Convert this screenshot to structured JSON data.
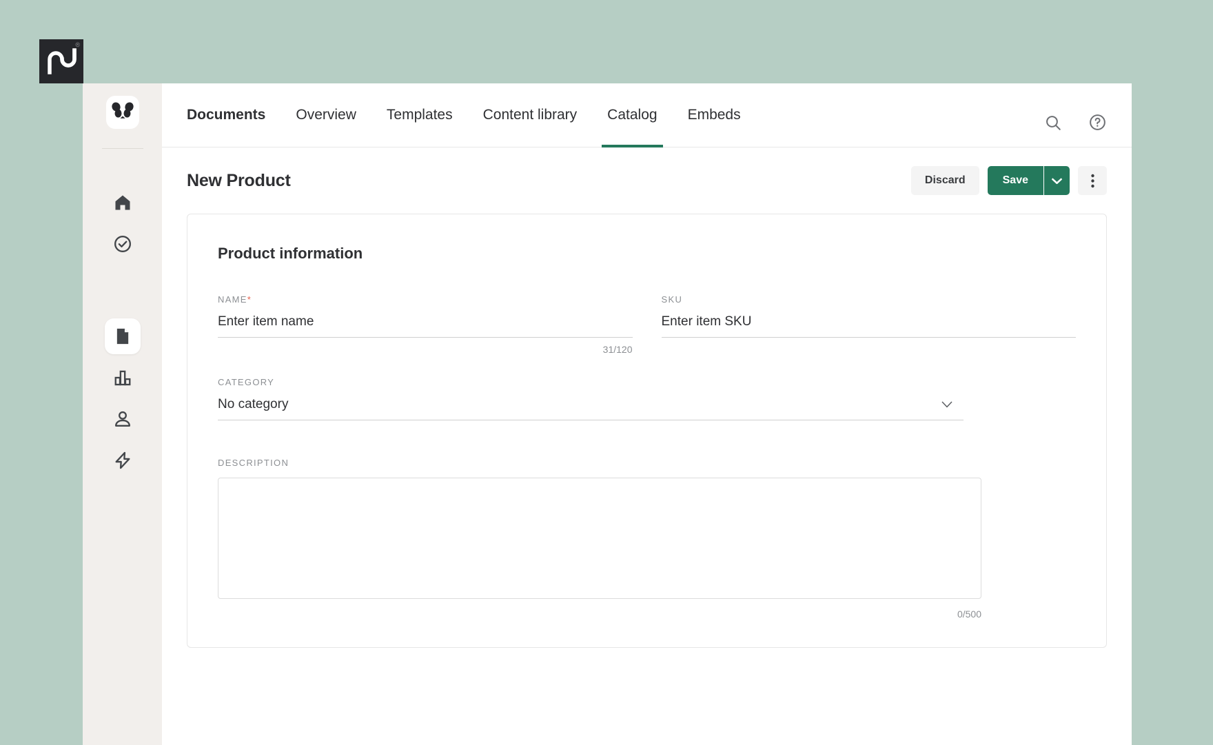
{
  "brand": {
    "logo_text": "pd",
    "registered_mark": "®"
  },
  "sidebar": {
    "avatar_name": "panda-avatar",
    "items": [
      {
        "icon": "home-icon",
        "label": "Home"
      },
      {
        "icon": "check-circle-icon",
        "label": "Tasks"
      },
      {
        "icon": "document-icon",
        "label": "Documents",
        "active": true
      },
      {
        "icon": "bar-chart-icon",
        "label": "Reports"
      },
      {
        "icon": "person-icon",
        "label": "Contacts"
      },
      {
        "icon": "lightning-icon",
        "label": "Automations"
      }
    ]
  },
  "topnav": {
    "tabs": [
      {
        "label": "Documents",
        "bold": true,
        "active": false
      },
      {
        "label": "Overview",
        "bold": false,
        "active": false
      },
      {
        "label": "Templates",
        "bold": false,
        "active": false
      },
      {
        "label": "Content library",
        "bold": false,
        "active": false
      },
      {
        "label": "Catalog",
        "bold": false,
        "active": true
      },
      {
        "label": "Embeds",
        "bold": false,
        "active": false
      }
    ],
    "search_icon": "search-icon",
    "help_icon": "help-circle-icon"
  },
  "page": {
    "title": "New Product",
    "discard_label": "Discard",
    "save_label": "Save",
    "save_caret_icon": "chevron-down-icon",
    "kebab_icon": "more-vertical-icon"
  },
  "card": {
    "title": "Product information",
    "fields": {
      "name": {
        "label": "NAME",
        "required_mark": "*",
        "value": "",
        "placeholder": "Enter item name",
        "counter": "31/120"
      },
      "sku": {
        "label": "SKU",
        "value": "",
        "placeholder": "Enter item SKU"
      },
      "category": {
        "label": "CATEGORY",
        "selected": "No category",
        "caret_icon": "chevron-down-icon"
      },
      "description": {
        "label": "DESCRIPTION",
        "value": "",
        "placeholder": "",
        "counter": "0/500"
      }
    }
  },
  "colors": {
    "page_background": "#b6cec4",
    "accent_green": "#24795c",
    "rail_background": "#f2efec",
    "required_red": "#e8604c",
    "logo_background": "#26272b"
  }
}
